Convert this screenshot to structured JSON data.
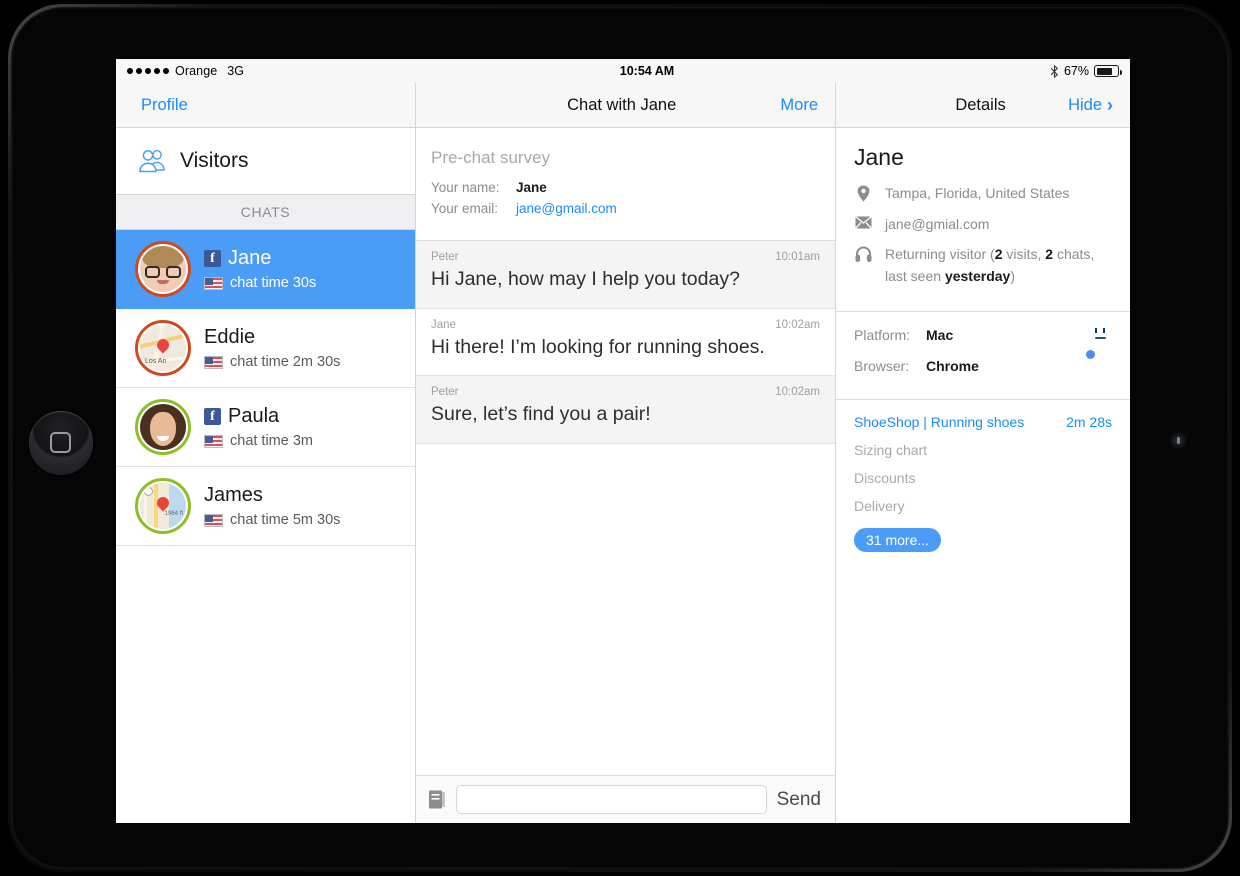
{
  "status_bar": {
    "signal_dots": 5,
    "carrier": "Orange",
    "network": "3G",
    "time": "10:54 AM",
    "bluetooth_icon": "bluetooth-icon",
    "battery_percent": "67%",
    "battery_level": 67
  },
  "nav": {
    "left_link": "Profile",
    "center_title": "Chat with Jane",
    "center_link": "More",
    "right_title": "Details",
    "right_link": "Hide",
    "right_chevron": "›"
  },
  "sidebar": {
    "visitors_label": "Visitors",
    "visitors_icon": "visitors-people-icon",
    "section_header": "CHATS",
    "chats": [
      {
        "name": "Jane",
        "time": "chat time 30s",
        "selected": true,
        "source_icon": "facebook-badge",
        "has_facebook": true,
        "avatar": "photo-woman-glasses",
        "ring": "#d24a1c",
        "flag": "us-flag-icon"
      },
      {
        "name": "Eddie",
        "time": "chat time 2m 30s",
        "selected": false,
        "source_icon": "map-thumbnail",
        "has_facebook": false,
        "avatar": "map-los-angeles",
        "ring": "#d24a1c",
        "flag": "us-flag-icon"
      },
      {
        "name": "Paula",
        "time": "chat time 3m",
        "selected": false,
        "source_icon": "facebook-badge",
        "has_facebook": true,
        "avatar": "photo-woman-smiling",
        "ring": "#8fbe28",
        "flag": "us-flag-icon"
      },
      {
        "name": "James",
        "time": "chat time 5m 30s",
        "selected": false,
        "source_icon": "map-thumbnail",
        "has_facebook": false,
        "avatar": "map-coastal",
        "ring": "#8fbe28",
        "flag": "us-flag-icon"
      }
    ]
  },
  "survey": {
    "title": "Pre-chat survey",
    "name_label": "Your name:",
    "name_value": "Jane",
    "email_label": "Your email:",
    "email_value": "jane@gmail.com"
  },
  "messages": [
    {
      "author": "Peter",
      "time": "10:01am",
      "text": "Hi Jane, how may I help you today?",
      "side": "agent"
    },
    {
      "author": "Jane",
      "time": "10:02am",
      "text": "Hi there! I’m looking for running shoes.",
      "side": "visitor"
    },
    {
      "author": "Peter",
      "time": "10:02am",
      "text": "Sure, let’s find you a pair!",
      "side": "agent"
    }
  ],
  "composer": {
    "canned_icon": "canned-responses-book-icon",
    "input_value": "",
    "placeholder": "",
    "send_label": "Send"
  },
  "details": {
    "visitor_name": "Jane",
    "location_icon": "location-pin-icon",
    "location": "Tampa, Florida, United States",
    "email_icon": "envelope-icon",
    "email": "jane@gmial.com",
    "visitor_icon": "headset-agent-icon",
    "returning_prefix": "Returning visitor (",
    "visits_count": "2",
    "visits_word": " visits, ",
    "chats_count": "2",
    "chats_word": " chats,",
    "last_seen_prefix": "last seen ",
    "last_seen_value": "yesterday",
    "last_seen_suffix": ")",
    "tech": [
      {
        "label": "Platform:",
        "value": "Mac",
        "icon": "mac-finder-icon"
      },
      {
        "label": "Browser:",
        "value": "Chrome",
        "icon": "chrome-icon"
      }
    ],
    "pages": [
      {
        "title": "ShoeShop | Running shoes",
        "duration": "2m 28s",
        "current": true
      },
      {
        "title": "Sizing chart",
        "duration": "",
        "current": false
      },
      {
        "title": "Discounts",
        "duration": "",
        "current": false
      },
      {
        "title": "Delivery",
        "duration": "",
        "current": false
      }
    ],
    "more_badge": "31 more..."
  },
  "colors": {
    "accent_blue": "#1a8cff",
    "selection_blue": "#4a9cf6",
    "facebook_blue": "#3b5998",
    "ring_orange": "#d24a1c",
    "ring_green": "#8fbe28"
  }
}
